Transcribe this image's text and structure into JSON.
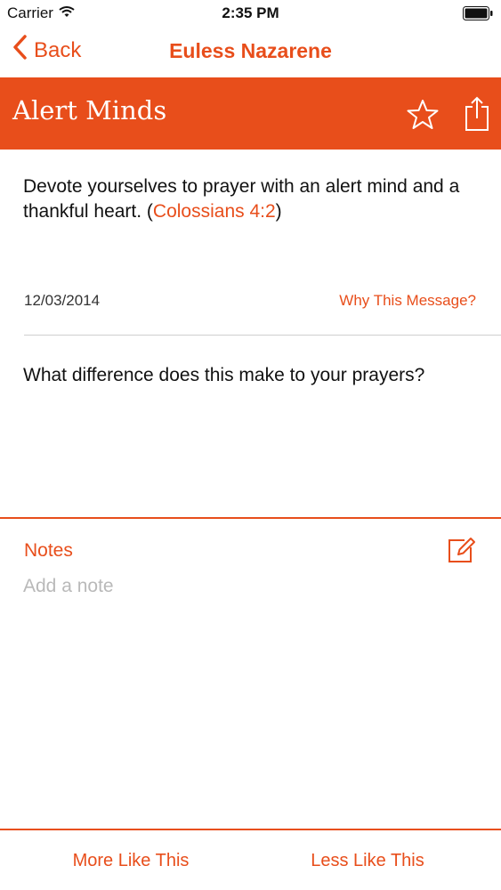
{
  "status_bar": {
    "carrier": "Carrier",
    "time": "2:35 PM"
  },
  "nav": {
    "back_label": "Back",
    "title": "Euless Nazarene"
  },
  "header": {
    "title": "Alert Minds"
  },
  "message": {
    "verse_text": "Devote yourselves to prayer with an alert mind and a thankful heart. (",
    "reference": "Colossians 4:2",
    "verse_close": ")",
    "date": "12/03/2014",
    "why_link": "Why This Message?",
    "question": "What difference does this make to your prayers?"
  },
  "notes": {
    "label": "Notes",
    "placeholder": "Add a note"
  },
  "bottom": {
    "more_label": "More Like This",
    "less_label": "Less Like This"
  },
  "colors": {
    "accent": "#e84e1b",
    "placeholder": "#b9b9b9",
    "divider": "#cfcfcf"
  },
  "icons": [
    "wifi-icon",
    "battery-icon",
    "chevron-left-icon",
    "star-icon",
    "share-icon",
    "edit-icon"
  ]
}
